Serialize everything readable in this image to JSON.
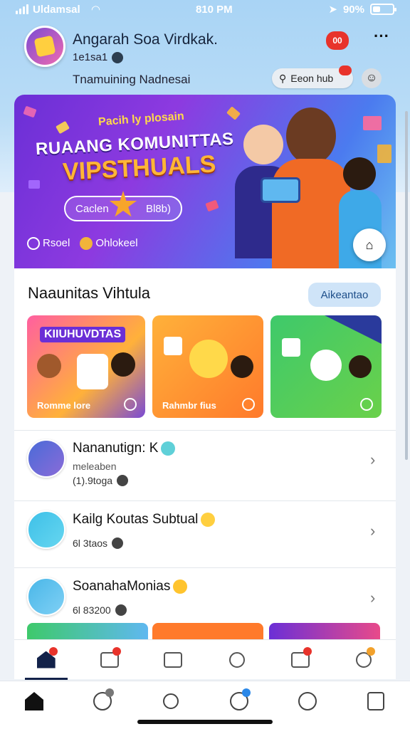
{
  "status_bar": {
    "carrier": "Uldamsal",
    "time": "810 PM",
    "battery": "90%"
  },
  "header": {
    "user_name": "Angarah Soa Virdkak.",
    "user_meta": "1e1sa1",
    "subtitle": "Tnamuining Nadnesai",
    "notif_badge": "00",
    "more_label": "···",
    "search_pill": "Eeon hub"
  },
  "hero": {
    "tag": "Pacih ly plosain",
    "title_line1": "RUAANG KOMUNITTAS",
    "title_line2": "VIPSTHUALS",
    "pill_left": "Caclen",
    "pill_right": "Bl8b)",
    "foot_left": "Rsoel",
    "foot_right": "Ohlokeel"
  },
  "section": {
    "title": "Naaunitas Vihtula",
    "button": "Aikeantao"
  },
  "tiles": [
    {
      "label": "Romme lore",
      "heading": "KIIUHUVDTAS"
    },
    {
      "label": "Rahmbr fius",
      "heading": ""
    },
    {
      "label": "",
      "heading": ""
    }
  ],
  "rows": [
    {
      "name": "Nananutign: K",
      "sub": "meleaben",
      "meta": "(1).9toga"
    },
    {
      "name": "Kailg Koutas Subtual",
      "sub": "",
      "meta": "6l 3taos"
    },
    {
      "name": "SoanahaMonias",
      "sub": "",
      "meta": "6l 83200"
    }
  ],
  "icons": {
    "chevron": "›"
  },
  "colors": {
    "accent": "#13224a",
    "badge_red": "#e8332b",
    "pill_blue": "#cfe4f8"
  }
}
